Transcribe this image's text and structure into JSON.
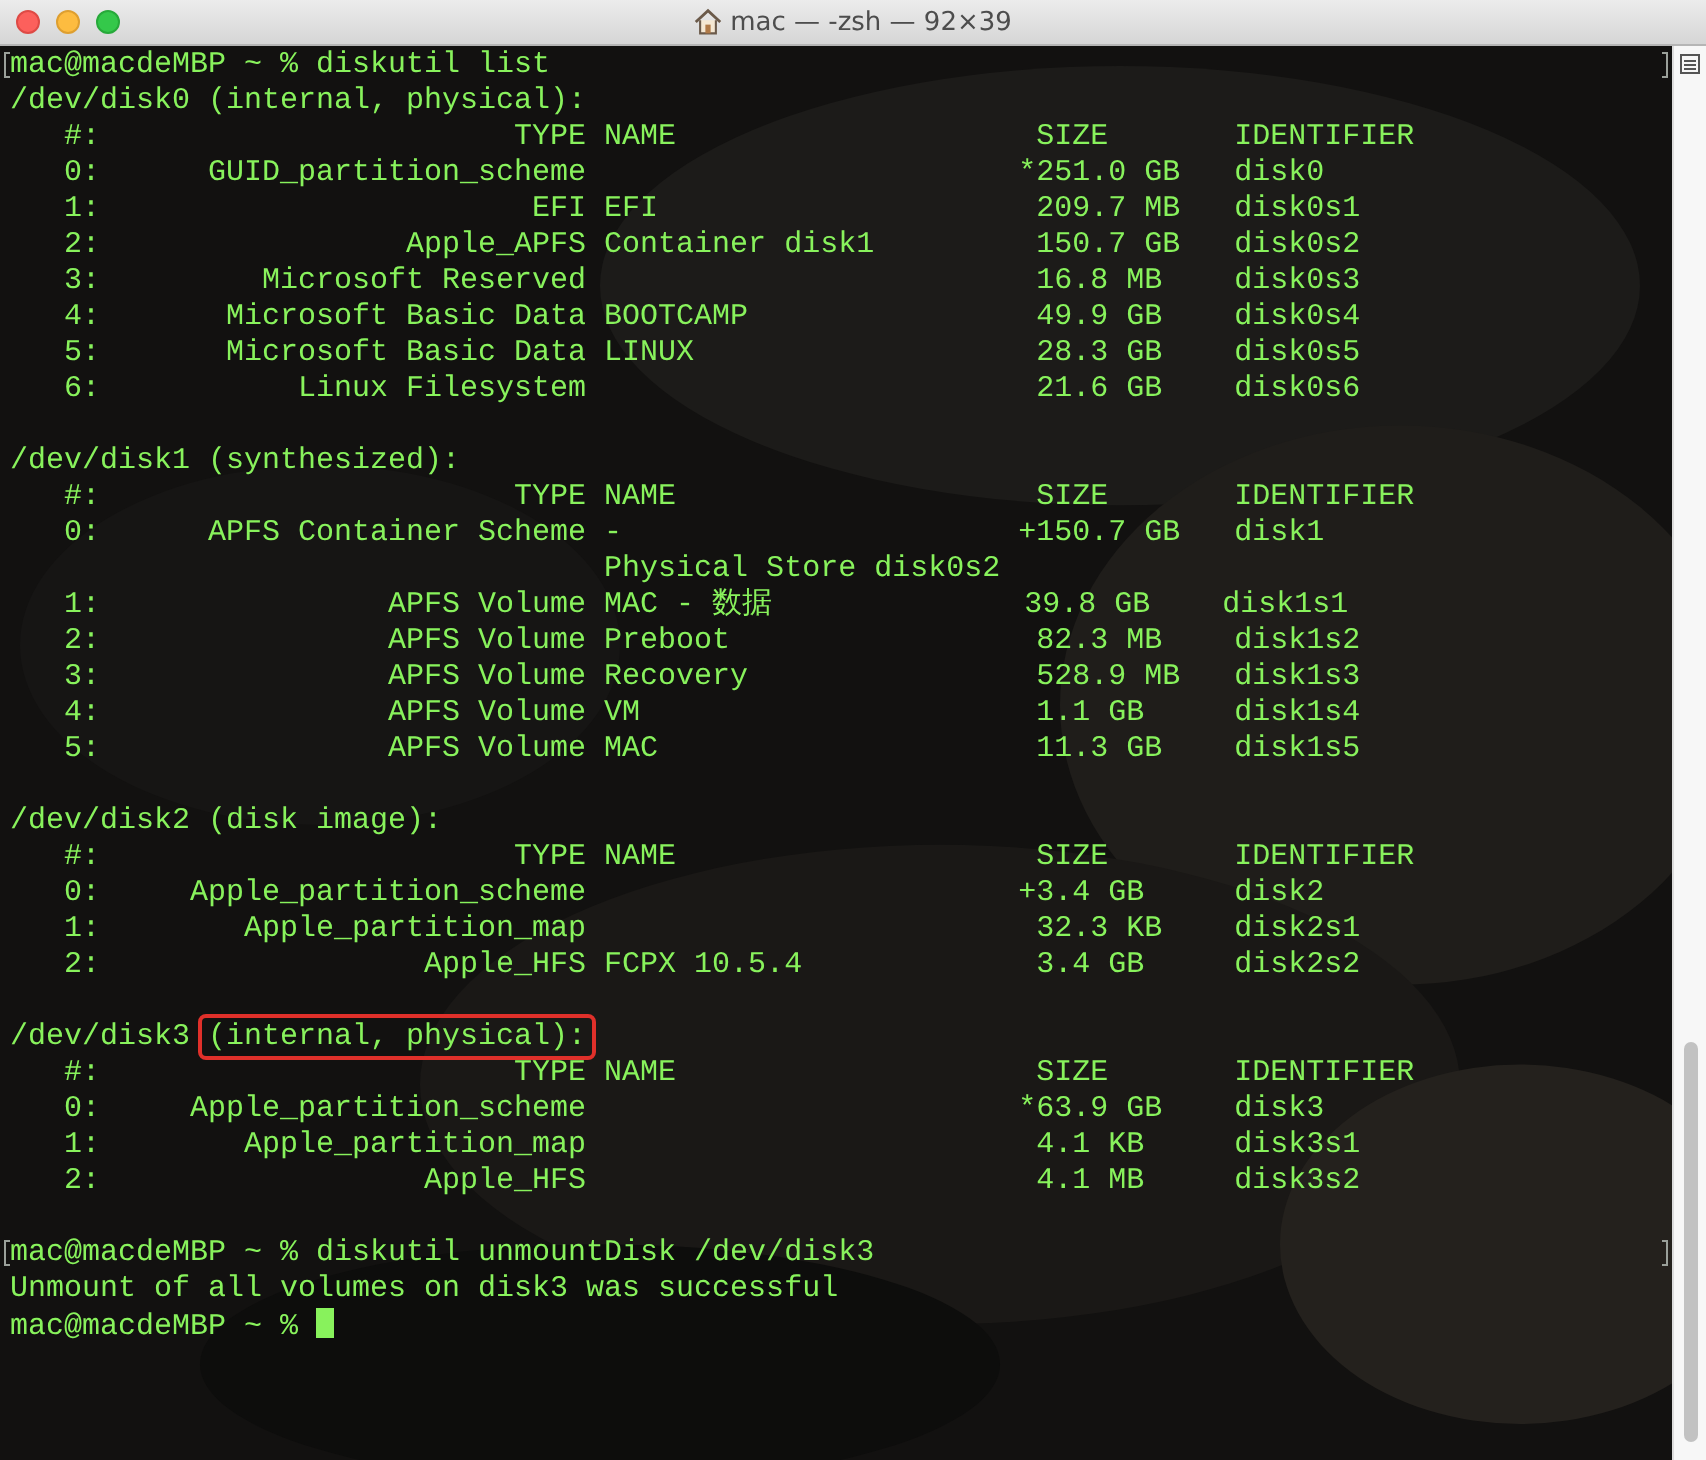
{
  "window": {
    "title": "mac — -zsh — 92×39"
  },
  "lines": [
    {
      "kind": "text",
      "text": "mac@macdeMBP ~ % diskutil list",
      "marked": true
    },
    {
      "kind": "text",
      "text": "/dev/disk0 (internal, physical):",
      "marked": false
    },
    {
      "kind": "text",
      "text": "   #:                       TYPE NAME                    SIZE       IDENTIFIER",
      "marked": false
    },
    {
      "kind": "text",
      "text": "   0:      GUID_partition_scheme                        *251.0 GB   disk0",
      "marked": false
    },
    {
      "kind": "text",
      "text": "   1:                        EFI EFI                     209.7 MB   disk0s1",
      "marked": false
    },
    {
      "kind": "text",
      "text": "   2:                 Apple_APFS Container disk1         150.7 GB   disk0s2",
      "marked": false
    },
    {
      "kind": "text",
      "text": "   3:         Microsoft Reserved                         16.8 MB    disk0s3",
      "marked": false
    },
    {
      "kind": "text",
      "text": "   4:       Microsoft Basic Data BOOTCAMP                49.9 GB    disk0s4",
      "marked": false
    },
    {
      "kind": "text",
      "text": "   5:       Microsoft Basic Data LINUX                   28.3 GB    disk0s5",
      "marked": false
    },
    {
      "kind": "text",
      "text": "   6:           Linux Filesystem                         21.6 GB    disk0s6",
      "marked": false
    },
    {
      "kind": "blank"
    },
    {
      "kind": "text",
      "text": "/dev/disk1 (synthesized):",
      "marked": false
    },
    {
      "kind": "text",
      "text": "   #:                       TYPE NAME                    SIZE       IDENTIFIER",
      "marked": false
    },
    {
      "kind": "text",
      "text": "   0:      APFS Container Scheme -                      +150.7 GB   disk1",
      "marked": false
    },
    {
      "kind": "text",
      "text": "                                 Physical Store disk0s2",
      "marked": false
    },
    {
      "kind": "text",
      "text": "   1:                APFS Volume MAC - 数据              39.8 GB    disk1s1",
      "marked": false
    },
    {
      "kind": "text",
      "text": "   2:                APFS Volume Preboot                 82.3 MB    disk1s2",
      "marked": false
    },
    {
      "kind": "text",
      "text": "   3:                APFS Volume Recovery                528.9 MB   disk1s3",
      "marked": false
    },
    {
      "kind": "text",
      "text": "   4:                APFS Volume VM                      1.1 GB     disk1s4",
      "marked": false
    },
    {
      "kind": "text",
      "text": "   5:                APFS Volume MAC                     11.3 GB    disk1s5",
      "marked": false
    },
    {
      "kind": "blank"
    },
    {
      "kind": "text",
      "text": "/dev/disk2 (disk image):",
      "marked": false
    },
    {
      "kind": "text",
      "text": "   #:                       TYPE NAME                    SIZE       IDENTIFIER",
      "marked": false
    },
    {
      "kind": "text",
      "text": "   0:     Apple_partition_scheme                        +3.4 GB     disk2",
      "marked": false
    },
    {
      "kind": "text",
      "text": "   1:        Apple_partition_map                         32.3 KB    disk2s1",
      "marked": false
    },
    {
      "kind": "text",
      "text": "   2:                  Apple_HFS FCPX 10.5.4             3.4 GB     disk2s2",
      "marked": false
    },
    {
      "kind": "blank"
    },
    {
      "kind": "text",
      "text": "/dev/disk3",
      "highlight": "(internal, physical):",
      "marked": false
    },
    {
      "kind": "text",
      "text": "   #:                       TYPE NAME                    SIZE       IDENTIFIER",
      "marked": false
    },
    {
      "kind": "text",
      "text": "   0:     Apple_partition_scheme                        *63.9 GB    disk3",
      "marked": false
    },
    {
      "kind": "text",
      "text": "   1:        Apple_partition_map                         4.1 KB     disk3s1",
      "marked": false
    },
    {
      "kind": "text",
      "text": "   2:                  Apple_HFS                         4.1 MB     disk3s2",
      "marked": false
    },
    {
      "kind": "blank"
    },
    {
      "kind": "text",
      "text": "mac@macdeMBP ~ % diskutil unmountDisk /dev/disk3",
      "marked": true
    },
    {
      "kind": "text",
      "text": "Unmount of all volumes on disk3 was successful",
      "marked": false
    },
    {
      "kind": "text",
      "text": "mac@macdeMBP ~ % ",
      "marked": false,
      "cursor": true
    }
  ]
}
